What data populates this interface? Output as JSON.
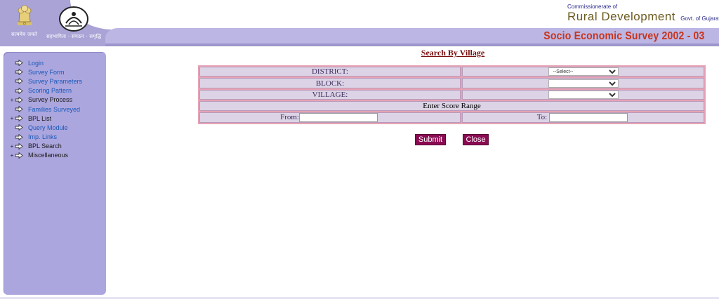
{
  "header": {
    "emblem_caption": "सत्यमेव जयते",
    "rd_caption": "सहभागिता · संगठन · समृद्धि",
    "commissionerate": "Commissionerate of",
    "department": "Rural  Development",
    "govt": "Govt. of Gujarat",
    "survey_title": "Socio Economic Survey 2002 - 03"
  },
  "sidebar": {
    "items": [
      {
        "label": "Login",
        "expander": "",
        "kind": "link"
      },
      {
        "label": "Survey Form",
        "expander": "",
        "kind": "link"
      },
      {
        "label": "Survey Parameters",
        "expander": "",
        "kind": "link"
      },
      {
        "label": "Scoring Pattern",
        "expander": "",
        "kind": "link"
      },
      {
        "label": "Survey Process",
        "expander": "+",
        "kind": "text"
      },
      {
        "label": "Families Surveyed",
        "expander": "",
        "kind": "link"
      },
      {
        "label": "BPL List",
        "expander": "+",
        "kind": "text"
      },
      {
        "label": "Query Module",
        "expander": "",
        "kind": "link"
      },
      {
        "label": "Imp. Links",
        "expander": "",
        "kind": "link"
      },
      {
        "label": "BPL Search",
        "expander": "+",
        "kind": "text"
      },
      {
        "label": "Miscellaneous",
        "expander": "+",
        "kind": "text"
      }
    ]
  },
  "main": {
    "title": "Search By Village",
    "form": {
      "district_label": "DISTRICT:",
      "district_selected": "--Select--",
      "block_label": "BLOCK:",
      "block_selected": "",
      "village_label": "VILLAGE:",
      "village_selected": "",
      "score_range_label": "Enter Score Range",
      "from_label": "From:",
      "from_value": "",
      "to_label": "To:",
      "to_value": ""
    },
    "buttons": {
      "submit": "Submit",
      "close": "Close"
    }
  },
  "colors": {
    "sidebar_bg": "#aca6de",
    "header_strip": "#bcb6e4",
    "title_red": "#c8341c",
    "button_bg": "#8a0b52",
    "table_border": "#e7a3b5",
    "link": "#1a59b8"
  },
  "icons": {
    "menu_bullet": "arrow-right-icon",
    "emblem": "national-emblem-icon",
    "rd_logo": "rural-development-logo-icon"
  }
}
